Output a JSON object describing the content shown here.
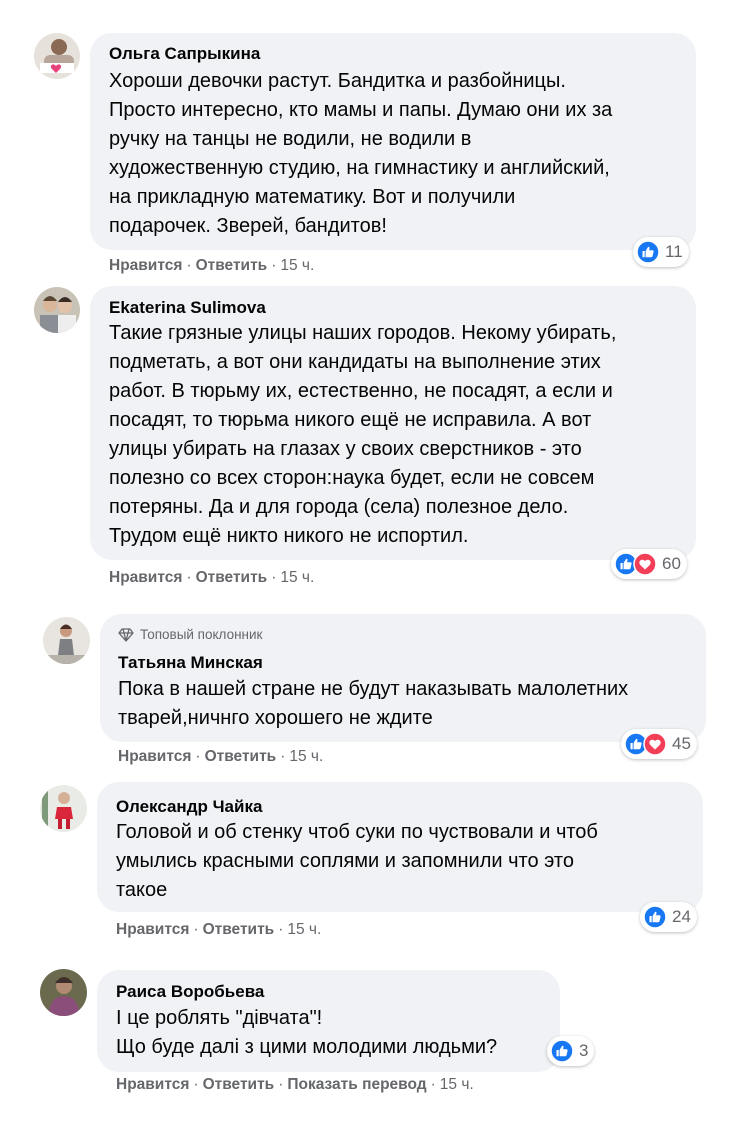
{
  "time_ago": "15 ч.",
  "actions": {
    "like": "Нравится",
    "reply": "Ответить",
    "translate": "Показать перевод"
  },
  "colors": {
    "like": "#1877f2",
    "love": "#f33e58",
    "bubble": "#f0f2f5",
    "meta": "#65676b"
  },
  "comments": [
    {
      "author": "Ольга Сапрыкина",
      "lines": [
        "Хороши девочки растут. Бандитка и разбойницы.",
        "Просто интересно, кто мамы и папы. Думаю они их за",
        "ручку на танцы не водили, не водили в",
        "художественную студию, на гимнастику и английский,",
        "на прикладную математику. Вот и получили",
        "подарочек. Зверей, бандитов!"
      ],
      "reactions": [
        "like-icon"
      ],
      "reaction_count": "11"
    },
    {
      "author": "Ekaterina Sulimova",
      "lines": [
        "Такие грязные улицы наших городов. Некому убирать,",
        "подметать, а вот они кандидаты на выполнение этих",
        "работ. В тюрьму их, естественно, не посадят, а если и",
        "посадят, то тюрьма никого ещё не исправила. А вот",
        "улицы убирать на глазах у своих сверстников - это",
        "полезно со всех сторон:наука будет, если не совсем",
        "потеряны. Да и для города (села) полезное дело.",
        "Трудом ещё никто никого не испортил."
      ],
      "reactions": [
        "like-icon",
        "love-icon"
      ],
      "reaction_count": "60"
    },
    {
      "badge": "Топовый поклонник",
      "author": "Татьяна Минская",
      "lines": [
        "Пока в нашей стране не будут наказывать малолетних",
        "тварей,ничнго хорошего не ждите"
      ],
      "reactions": [
        "like-icon",
        "love-icon"
      ],
      "reaction_count": "45"
    },
    {
      "author": "Олександр Чайка",
      "lines": [
        "Головой и об стенку чтоб суки по чуствовали и чтоб",
        "умылись красными соплями и запомнили что это",
        "такое"
      ],
      "reactions": [
        "like-icon"
      ],
      "reaction_count": "24"
    },
    {
      "author": "Раиса Воробьева",
      "lines": [
        "І це роблять \"дівчата\"!",
        "Що буде далі з цими молодими людьми?"
      ],
      "reactions": [
        "like-icon"
      ],
      "reaction_count": "3"
    }
  ]
}
